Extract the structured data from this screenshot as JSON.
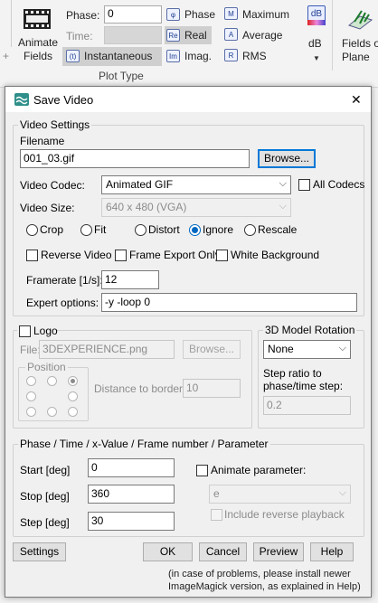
{
  "ribbon": {
    "animate_fields_label": "Animate\nFields",
    "phase_label": "Phase:",
    "phase_value": "0",
    "time_label": "Time:",
    "instantaneous_label": "Instantaneous",
    "phase_btn": "Phase",
    "real_btn": "Real",
    "imag_btn": "Imag.",
    "maximum_btn": "Maximum",
    "average_btn": "Average",
    "rms_btn": "RMS",
    "db_label": "dB",
    "db_icon": "dB",
    "plot_type_label": "Plot Type",
    "fields_on_plane_label": "Fields on\nPlane",
    "icon_phase": "φ",
    "icon_real": "Re",
    "icon_instant": "(t)",
    "icon_imag": "Im",
    "icon_max": "M",
    "icon_avg": "A",
    "icon_rms": "R"
  },
  "dialog": {
    "title": "Save Video",
    "close": "✕",
    "video_settings": {
      "title": "Video Settings",
      "filename_label": "Filename",
      "filename_value": "001_03.gif",
      "browse_label": "Browse...",
      "codec_label": "Video Codec:",
      "codec_value": "Animated GIF",
      "all_codecs_label": "All Codecs",
      "size_label": "Video Size:",
      "size_value": "640 x 480 (VGA)",
      "radios": [
        {
          "label": "Crop",
          "checked": false
        },
        {
          "label": "Fit",
          "checked": false
        },
        {
          "label": "Distort",
          "checked": false
        },
        {
          "label": "Ignore",
          "checked": true
        },
        {
          "label": "Rescale",
          "checked": false
        }
      ],
      "reverse_video_label": "Reverse Video",
      "frame_export_label": "Frame Export Only",
      "white_bg_label": "White Background",
      "framerate_label": "Framerate [1/s]:",
      "framerate_value": "12",
      "expert_label": "Expert options:",
      "expert_value": "-y -loop 0"
    },
    "logo": {
      "title": "Logo",
      "file_label": "File:",
      "file_value": "3DEXPERIENCE.png",
      "browse_label": "Browse...",
      "position_label": "Position",
      "distance_label": "Distance to border:",
      "distance_value": "10",
      "position_selected": 2
    },
    "model_rotation": {
      "title": "3D Model Rotation",
      "value": "None",
      "step_ratio_label": "Step ratio to\nphase/time step:",
      "step_value": "0.2"
    },
    "phase_group": {
      "title": "Phase / Time / x-Value / Frame number / Parameter",
      "start_label": "Start [deg]",
      "start_value": "0",
      "stop_label": "Stop [deg]",
      "stop_value": "360",
      "step_label": "Step [deg]",
      "step_value": "30",
      "animate_param_label": "Animate parameter:",
      "param_value": "e",
      "reverse_playback_label": "Include reverse playback"
    },
    "buttons": {
      "settings": "Settings",
      "ok": "OK",
      "cancel": "Cancel",
      "preview": "Preview",
      "help": "Help"
    },
    "footer_note": "(in case of problems, please install newer\nImageMagick version, as explained in Help)"
  },
  "colors": {
    "accent": "#0067c0",
    "title_icon": "#2f8f8a"
  }
}
